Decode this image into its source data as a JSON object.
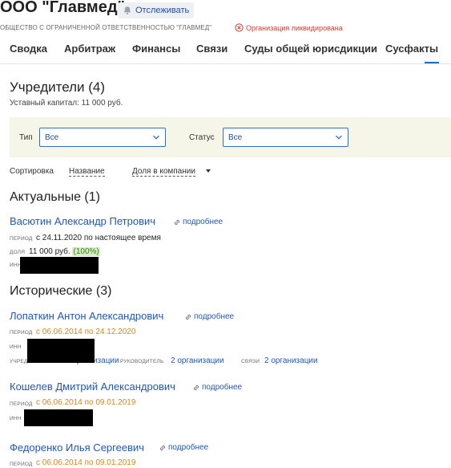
{
  "header": {
    "title": "ООО \"Главмед\"",
    "follow_label": "Отслеживать",
    "full_name": "ОБЩЕСТВО С ОГРАНИЧЕННОЙ ОТВЕТСТВЕННОСТЬЮ \"ГЛАВМЕД\"",
    "status": "Организация ликвидирована",
    "status_color": "#d33a2c"
  },
  "tabs": [
    "Сводка",
    "Арбитраж",
    "Финансы",
    "Связи",
    "Суды общей юрисдикции",
    "Сусфакты"
  ],
  "founders": {
    "title": "Учредители (4)",
    "capital": "Уставный капитал: 11 000 руб."
  },
  "filters": {
    "type_label": "Тип",
    "type_value": "Все",
    "status_label": "Статус",
    "status_value": "Все"
  },
  "sort": {
    "label": "Сортировка",
    "by_name": "Название",
    "by_share": "Доля в компании"
  },
  "current": {
    "title": "Актуальные (1)",
    "people": [
      {
        "name": "Васютин Александр Петрович",
        "more": "подробнее",
        "period_label": "период",
        "period": "с 24.11.2020 по настоящее время",
        "share_label": "доля",
        "share": "11 000 руб.",
        "share_pct": "(100%)",
        "inn_label": "инн"
      }
    ]
  },
  "historical": {
    "title": "Исторические (3)",
    "people": [
      {
        "name": "Лопаткин Антон Александрович",
        "more": "подробнее",
        "period_label": "период",
        "period": "с 06.06.2014 по 24.12.2020",
        "inn_label": "инн",
        "founder_label": "учредитель",
        "founder_link": "2 организации",
        "director_label": "руководитель",
        "director_link": "2 организации",
        "links_label": "связи",
        "links_link": "2 организации"
      },
      {
        "name": "Кошелев Дмитрий Александрович",
        "more": "подробнее",
        "period_label": "период",
        "period": "с 06.06.2014 по 09.01.2019",
        "inn_label": "инн"
      },
      {
        "name": "Федоренко Илья Сергеевич",
        "more": "подробнее",
        "period_label": "период",
        "period": "с 06.06.2014 по 09.01.2019"
      }
    ]
  },
  "colors": {
    "link": "#1f58b8",
    "accent": "#1f6bd6",
    "historical_period": "#d8871a",
    "share_badge": "#d8efc6"
  }
}
